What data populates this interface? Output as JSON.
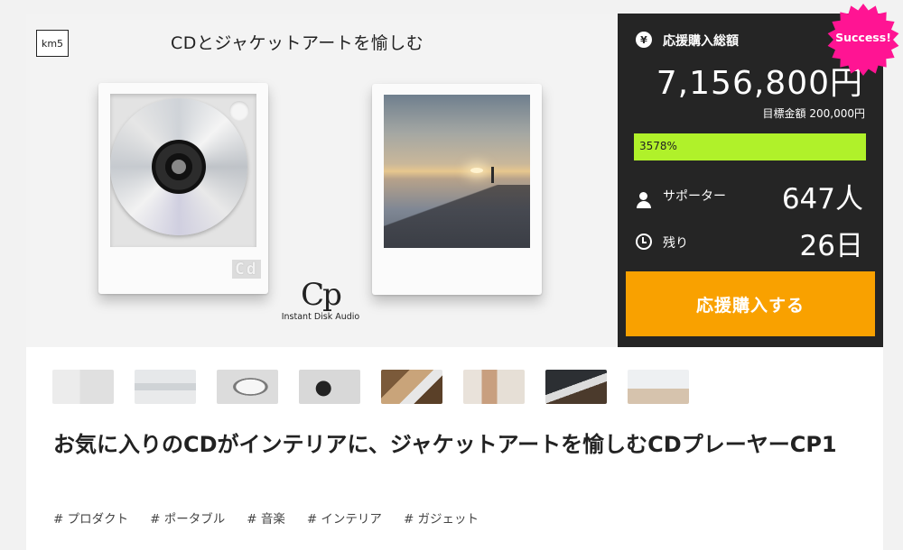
{
  "hero": {
    "brand_logo": "km5",
    "caption": "CDとジャケットアートを愉しむ",
    "lcd_text": "Cd",
    "product_logo_mark": "Cp",
    "product_logo_sub": "Instant Disk Audio"
  },
  "badge": {
    "label": "Success!",
    "color": "#ff1493"
  },
  "panel": {
    "yen_icon": "¥",
    "total_label": "応援購入総額",
    "total_amount": "7,156,800円",
    "target_label": "目標金額 200,000円",
    "progress_text": "3578%",
    "progress_fraction": 1.0,
    "supporters_label": "サポーター",
    "supporters_value": "647人",
    "remaining_label": "残り",
    "remaining_value": "26日",
    "cta_label": "応援購入する",
    "accent_color": "#f9a100",
    "progress_color": "#b0f12a"
  },
  "thumbnails": [
    {
      "name": "thumbnail-1"
    },
    {
      "name": "thumbnail-2"
    },
    {
      "name": "thumbnail-3"
    },
    {
      "name": "thumbnail-4"
    },
    {
      "name": "thumbnail-5"
    },
    {
      "name": "thumbnail-6"
    },
    {
      "name": "thumbnail-7"
    },
    {
      "name": "thumbnail-8"
    }
  ],
  "project_title": "お気に入りのCDがインテリアに、ジャケットアートを愉しむCDプレーヤーCP1",
  "tags": [
    "# プロダクト",
    "# ポータブル",
    "# 音楽",
    "# インテリア",
    "# ガジェット"
  ]
}
